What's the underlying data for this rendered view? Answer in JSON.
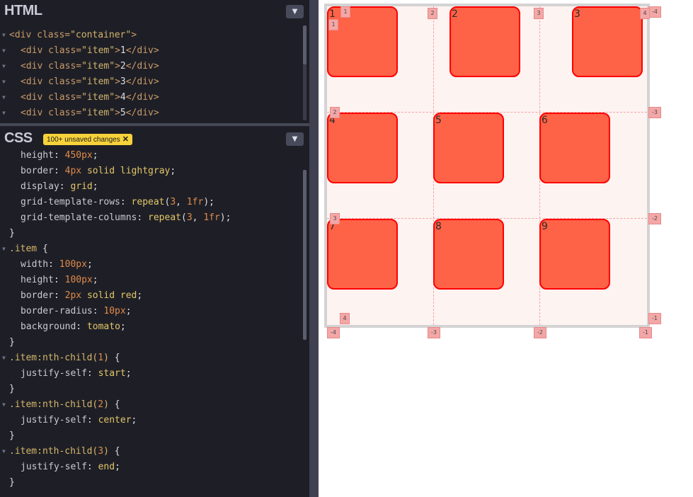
{
  "html_panel": {
    "title": "HTML",
    "lines": [
      {
        "tag_open": "<div class=",
        "attr": "\"container\"",
        "tag_close": ">",
        "content": "",
        "end": ""
      },
      {
        "tag_open": "<div class=",
        "attr": "\"item\"",
        "tag_close": ">",
        "content": "1",
        "end": "</div>"
      },
      {
        "tag_open": "<div class=",
        "attr": "\"item\"",
        "tag_close": ">",
        "content": "2",
        "end": "</div>"
      },
      {
        "tag_open": "<div class=",
        "attr": "\"item\"",
        "tag_close": ">",
        "content": "3",
        "end": "</div>"
      },
      {
        "tag_open": "<div class=",
        "attr": "\"item\"",
        "tag_close": ">",
        "content": "4",
        "end": "</div>"
      },
      {
        "tag_open": "<div class=",
        "attr": "\"item\"",
        "tag_close": ">",
        "content": "5",
        "end": "</div>"
      }
    ]
  },
  "css_panel": {
    "title": "CSS",
    "badge": "100+ unsaved changes",
    "lines": [
      {
        "prop": "height",
        "value": "450px"
      },
      {
        "prop": "border",
        "value": "4px solid lightgray"
      },
      {
        "prop": "display",
        "value": "grid"
      },
      {
        "prop": "grid-template-rows",
        "value": "repeat(3, 1fr)"
      },
      {
        "prop": "grid-template-columns",
        "value": "repeat(3, 1fr)"
      },
      {
        "close": "}"
      },
      {
        "selector": ".item",
        "open": "{"
      },
      {
        "prop": "width",
        "value": "100px"
      },
      {
        "prop": "height",
        "value": "100px"
      },
      {
        "prop": "border",
        "value": "2px solid red"
      },
      {
        "prop": "border-radius",
        "value": "10px"
      },
      {
        "prop": "background",
        "value": "tomato"
      },
      {
        "close": "}"
      },
      {
        "selector": ".item:nth-child(1)",
        "open": "{"
      },
      {
        "prop": "justify-self",
        "value": "start"
      },
      {
        "close": "}"
      },
      {
        "selector": ".item:nth-child(2)",
        "open": "{"
      },
      {
        "prop": "justify-self",
        "value": "center"
      },
      {
        "close": "}"
      },
      {
        "selector": ".item:nth-child(3)",
        "open": "{"
      },
      {
        "prop": "justify-self",
        "value": "end"
      },
      {
        "close": "}"
      }
    ]
  },
  "icons": {
    "collapse": "chevron-down-icon",
    "close": "close-icon"
  },
  "colors": {
    "item_fill": "#ff6347",
    "item_border": "#ff0000",
    "grid_label": "#f3a7a7",
    "badge": "#f7d23a"
  },
  "preview": {
    "items": [
      "1",
      "2",
      "3",
      "4",
      "5",
      "6",
      "7",
      "8",
      "9"
    ],
    "row_labels_left": [
      "1",
      "2",
      "3",
      "4"
    ],
    "row_labels_right": [
      "-4",
      "-3",
      "-2",
      "-1"
    ],
    "col_labels_top": [
      "1",
      "2",
      "3",
      "4"
    ],
    "col_labels_bottom": [
      "-4",
      "-3",
      "-2",
      "-1"
    ]
  }
}
